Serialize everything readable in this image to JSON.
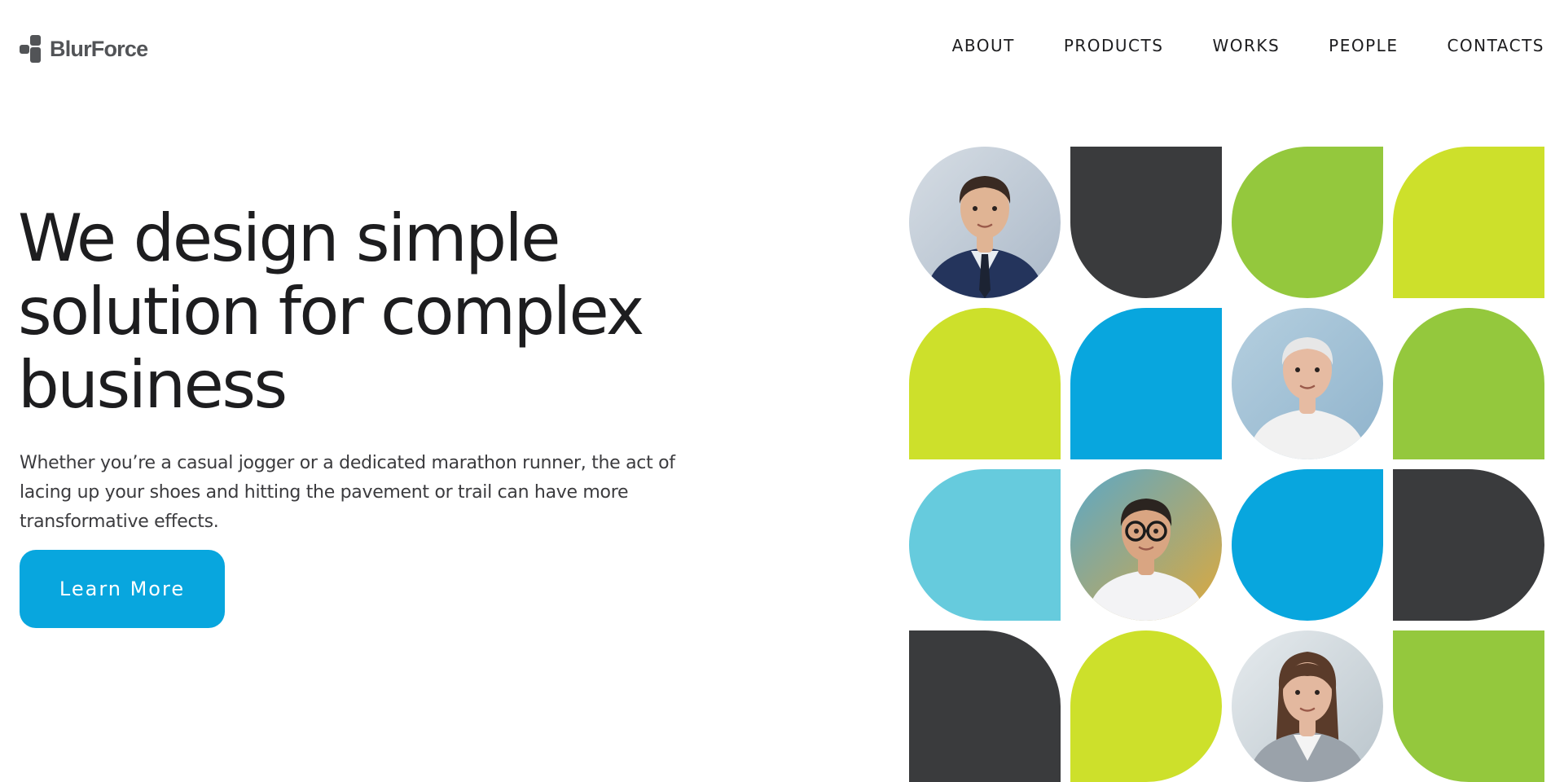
{
  "brand": {
    "name": "BlurForce",
    "mark_color": "#525457"
  },
  "nav": [
    {
      "key": "about",
      "label": "ABOUT"
    },
    {
      "key": "products",
      "label": "PRODUCTS"
    },
    {
      "key": "works",
      "label": "WORKS"
    },
    {
      "key": "people",
      "label": "PEOPLE"
    },
    {
      "key": "contacts",
      "label": "CONTACTS"
    }
  ],
  "hero": {
    "title_lines": [
      "We design simple",
      "solution for complex",
      "business"
    ],
    "description_lines": [
      "Whether you’re a casual jogger or a dedicated marathon runner, the act of",
      "lacing up your shoes and hitting the pavement or trail can have more",
      "transformative effects."
    ],
    "cta_label": "Learn More"
  },
  "colors": {
    "accent_blue": "#08a6de",
    "dark": "#3a3b3d",
    "green": "#94c83d",
    "lime": "#cde02b",
    "light_blue": "#66cbdd",
    "text": "#1d1d1f"
  },
  "mosaic_tiles": [
    {
      "name": "photo-businessman",
      "kind": "photo",
      "subject": "man-in-suit"
    },
    {
      "name": "tile-dark-bottom-round",
      "kind": "shape",
      "shape": "round-bottom",
      "color": "#3a3b3d"
    },
    {
      "name": "tile-green-leaf",
      "kind": "shape",
      "shape": "leaf-tr",
      "color": "#94c83d"
    },
    {
      "name": "tile-lime-top-left",
      "kind": "shape",
      "shape": "round-tl",
      "color": "#cde02b"
    },
    {
      "name": "tile-lime-arch",
      "kind": "shape",
      "shape": "round-top",
      "color": "#cde02b"
    },
    {
      "name": "tile-blue-top-left",
      "kind": "shape",
      "shape": "round-tl",
      "color": "#08a6de"
    },
    {
      "name": "photo-elderly-man",
      "kind": "photo",
      "subject": "elderly-man"
    },
    {
      "name": "tile-green-arch",
      "kind": "shape",
      "shape": "round-top",
      "color": "#94c83d"
    },
    {
      "name": "tile-lightblue-left-round",
      "kind": "shape",
      "shape": "round-left",
      "color": "#66cbdd"
    },
    {
      "name": "photo-boy-glasses",
      "kind": "photo",
      "subject": "boy-with-glasses"
    },
    {
      "name": "tile-blue-leaf",
      "kind": "shape",
      "shape": "leaf-tr",
      "color": "#08a6de"
    },
    {
      "name": "tile-dark-right-round",
      "kind": "shape",
      "shape": "round-right",
      "color": "#3a3b3d"
    },
    {
      "name": "tile-dark-top-right",
      "kind": "shape",
      "shape": "round-tr",
      "color": "#3a3b3d"
    },
    {
      "name": "tile-lime-leaf",
      "kind": "shape",
      "shape": "leaf-bl",
      "color": "#cde02b"
    },
    {
      "name": "photo-woman-blazer",
      "kind": "photo",
      "subject": "woman-in-blazer"
    },
    {
      "name": "tile-green-bottom-left",
      "kind": "shape",
      "shape": "round-bl",
      "color": "#94c83d"
    }
  ]
}
